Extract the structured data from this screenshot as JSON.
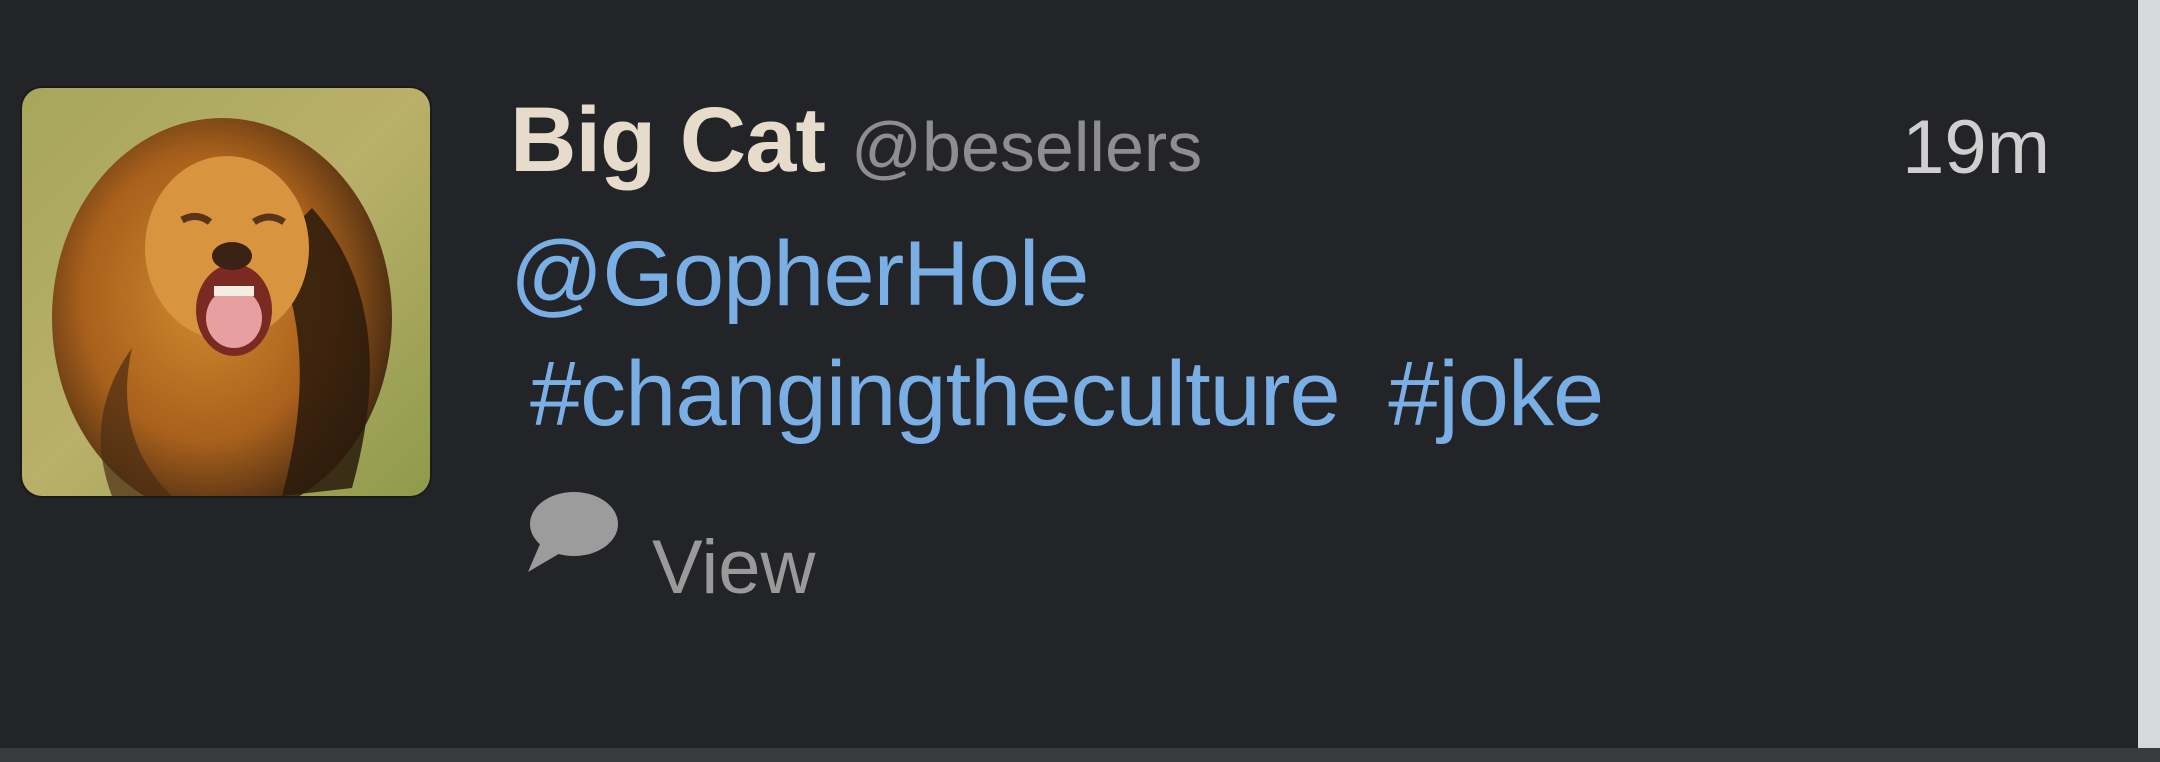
{
  "tweet": {
    "display_name": "Big Cat",
    "screen_name": "@besellers",
    "timestamp": "19m",
    "mention": "@GopherHole",
    "hashtags": [
      "#changingtheculture",
      "#joke"
    ],
    "avatar_icon": "lion-avatar",
    "actions": {
      "comment_icon": "speech-bubble-icon",
      "view_label": "View"
    }
  },
  "colors": {
    "background": "#232427",
    "display_name": "#e7dccb",
    "screen_name": "#8e8e8e",
    "link": "#7aafe6",
    "muted": "#9a9a9a"
  }
}
